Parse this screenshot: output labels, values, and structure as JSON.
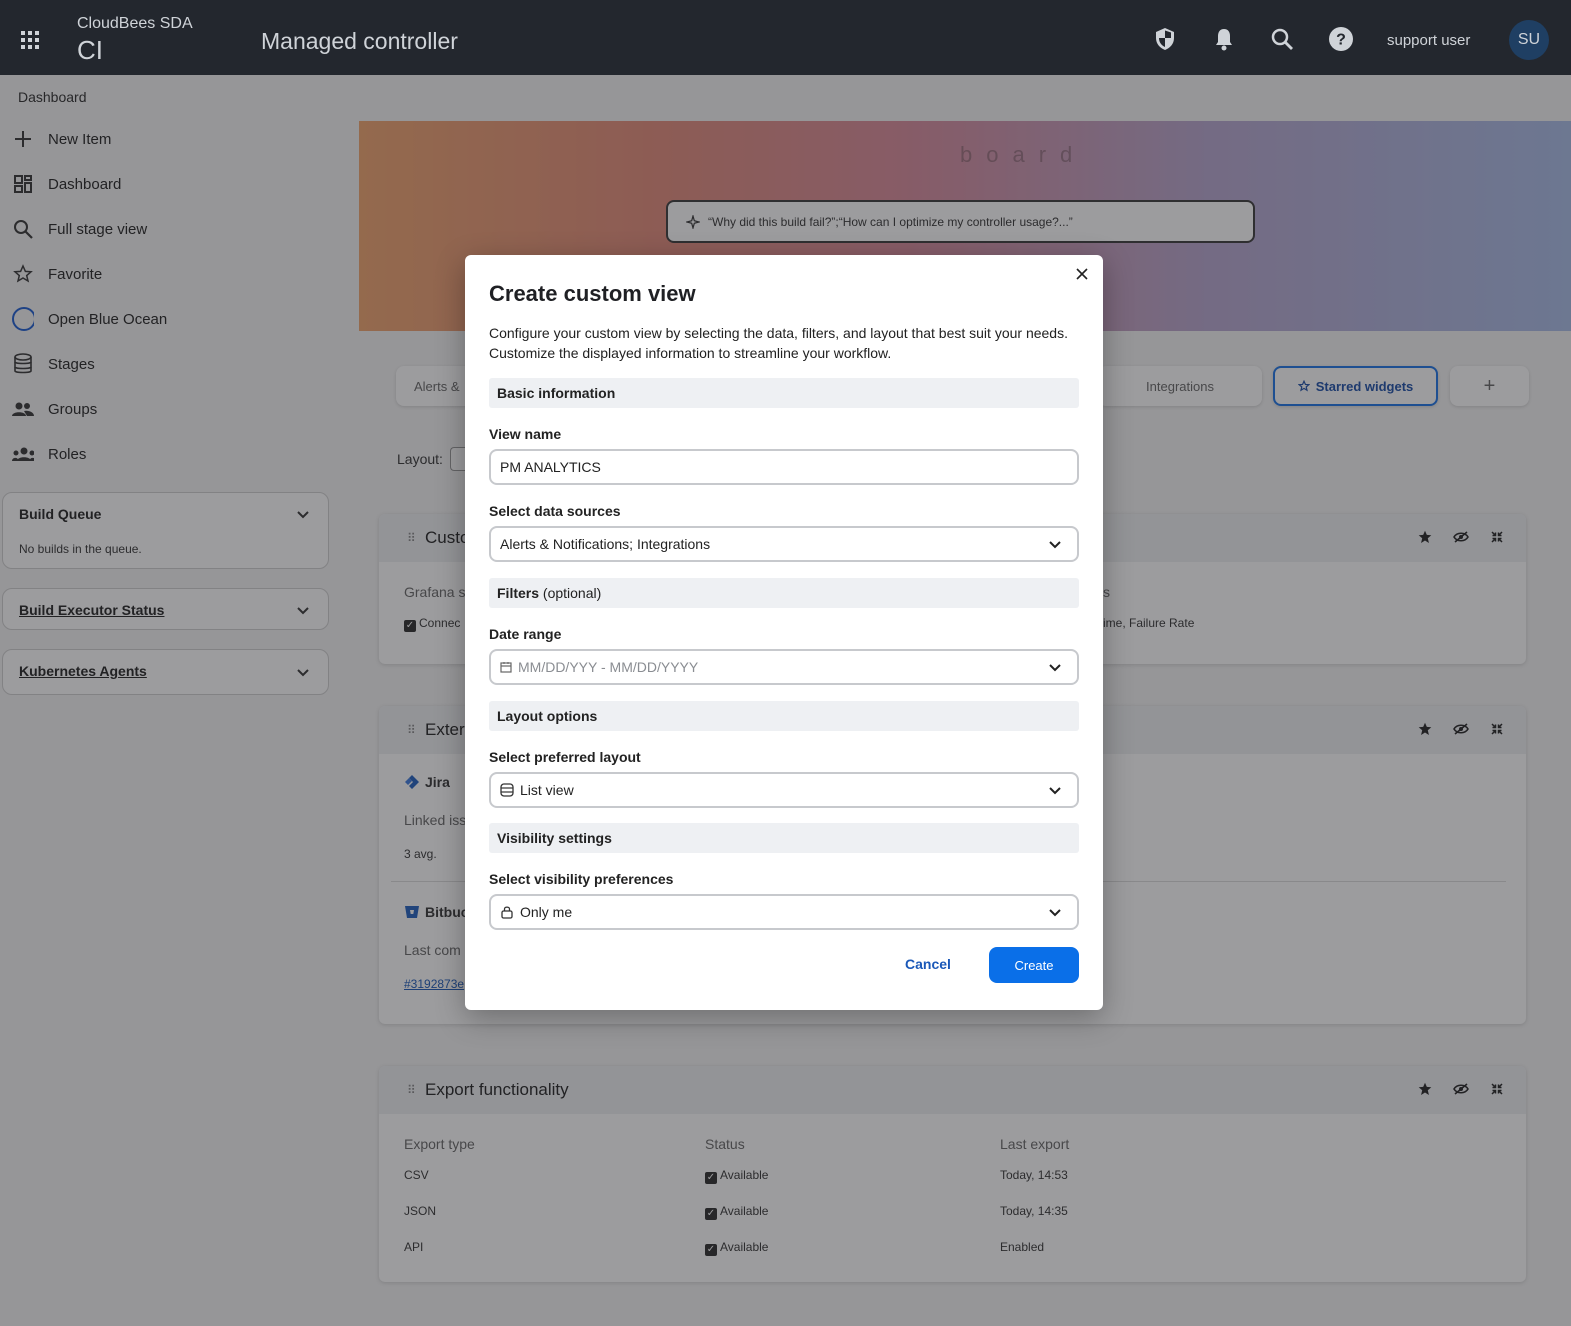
{
  "topbar": {
    "brand_top": "CloudBees SDA",
    "brand_bottom": "CI",
    "title": "Managed controller",
    "user_name": "support user",
    "avatar_initials": "SU"
  },
  "breadcrumb": "Dashboard",
  "sidebar": {
    "items": [
      {
        "label": "New Item",
        "icon": "plus-icon"
      },
      {
        "label": "Dashboard",
        "icon": "grid-icon"
      },
      {
        "label": "Full stage view",
        "icon": "search-icon"
      },
      {
        "label": "Favorite",
        "icon": "star-icon"
      },
      {
        "label": "Open Blue Ocean",
        "icon": "circle-icon"
      },
      {
        "label": "Stages",
        "icon": "database-icon"
      },
      {
        "label": "Groups",
        "icon": "people-icon"
      },
      {
        "label": "Roles",
        "icon": "roles-icon"
      }
    ],
    "build_queue": {
      "title": "Build Queue",
      "empty": "No builds in the queue."
    },
    "build_executor": {
      "title": "Build Executor Status"
    },
    "kubernetes": {
      "title": "Kubernetes Agents"
    }
  },
  "hero": {
    "faded_text": "board",
    "ai_placeholder": "“Why did this build fail?”;“How can I optimize my controller usage?...”"
  },
  "tabs": {
    "alerts": "Alerts &",
    "integrations": "Integrations",
    "starred": "Starred widgets",
    "add": "+"
  },
  "layout_label": "Layout:",
  "cards": {
    "custom": {
      "title": "Custo",
      "grafana": "Grafana s",
      "connect": "Connec",
      "right_fragment": "s",
      "metrics": "ime, Failure Rate"
    },
    "external": {
      "title": "Exter",
      "jira": "Jira",
      "linked": "Linked iss",
      "avg": "3 avg.",
      "bitbucket": "Bitbuc",
      "last_commit": "Last com",
      "commit_link": "#3192873e"
    },
    "export": {
      "title": "Export functionality",
      "headers": [
        "Export type",
        "Status",
        "Last export"
      ],
      "rows": [
        {
          "type": "CSV",
          "status": "Available",
          "last": "Today, 14:53"
        },
        {
          "type": "JSON",
          "status": "Available",
          "last": "Today, 14:35"
        },
        {
          "type": "API",
          "status": "Available",
          "last": "Enabled"
        }
      ]
    }
  },
  "modal": {
    "title": "Create custom view",
    "description": "Configure your custom view by selecting the data, filters, and layout that best suit your needs. Customize the displayed information to streamline your workflow.",
    "sections": {
      "basic": "Basic information",
      "filters": "Filters",
      "filters_optional": "(optional)",
      "layout": "Layout options",
      "visibility": "Visibility settings"
    },
    "view_name": {
      "label": "View name",
      "value": "PM ANALYTICS"
    },
    "data_sources": {
      "label": "Select data sources",
      "value": "Alerts & Notifications; Integrations"
    },
    "date_range": {
      "label": "Date range",
      "placeholder": "MM/DD/YYY - MM/DD/YYYY"
    },
    "layout": {
      "label": "Select preferred layout",
      "value": "List view"
    },
    "visibility": {
      "label": "Select visibility preferences",
      "value": "Only me"
    },
    "cancel": "Cancel",
    "create": "Create"
  },
  "colors": {
    "topbar": "#23272e",
    "primary": "#0a6fe8",
    "link": "#1a58b8"
  }
}
